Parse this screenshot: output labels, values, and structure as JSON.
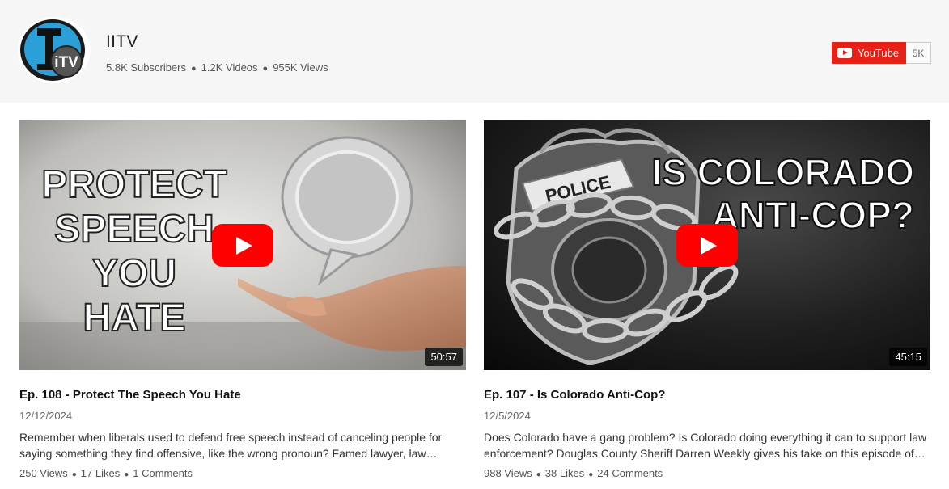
{
  "channel": {
    "name": "IITV",
    "stats": {
      "subscribers": "5.8K Subscribers",
      "videos": "1.2K Videos",
      "views": "955K Views"
    },
    "logo_text": "iTV"
  },
  "youtube_button": {
    "label": "YouTube",
    "count": "5K",
    "color": "#e62117"
  },
  "videos": [
    {
      "thumb_lines": [
        "PROTECT",
        "SPEECH",
        "YOU",
        "HATE"
      ],
      "duration": "50:57",
      "title": "Ep. 108 - Protect The Speech You Hate",
      "date": "12/12/2024",
      "description": "Remember when liberals used to defend free speech instead of canceling people for saying something they find offensive, like the wrong pronoun? Famed lawyer, law…",
      "views": "250 Views",
      "likes": "17 Likes",
      "comments": "1 Comments"
    },
    {
      "thumb_lines": [
        "IS COLORADO",
        "ANTI-COP?"
      ],
      "badge_text": "POLICE",
      "duration": "45:15",
      "title": "Ep. 107 - Is Colorado Anti-Cop?",
      "date": "12/5/2024",
      "description": "Does Colorado have a gang problem? Is Colorado doing everything it can to support law enforcement? Douglas County Sheriff Darren Weekly gives his take on this episode of…",
      "views": "988 Views",
      "likes": "38 Likes",
      "comments": "24 Comments"
    }
  ]
}
